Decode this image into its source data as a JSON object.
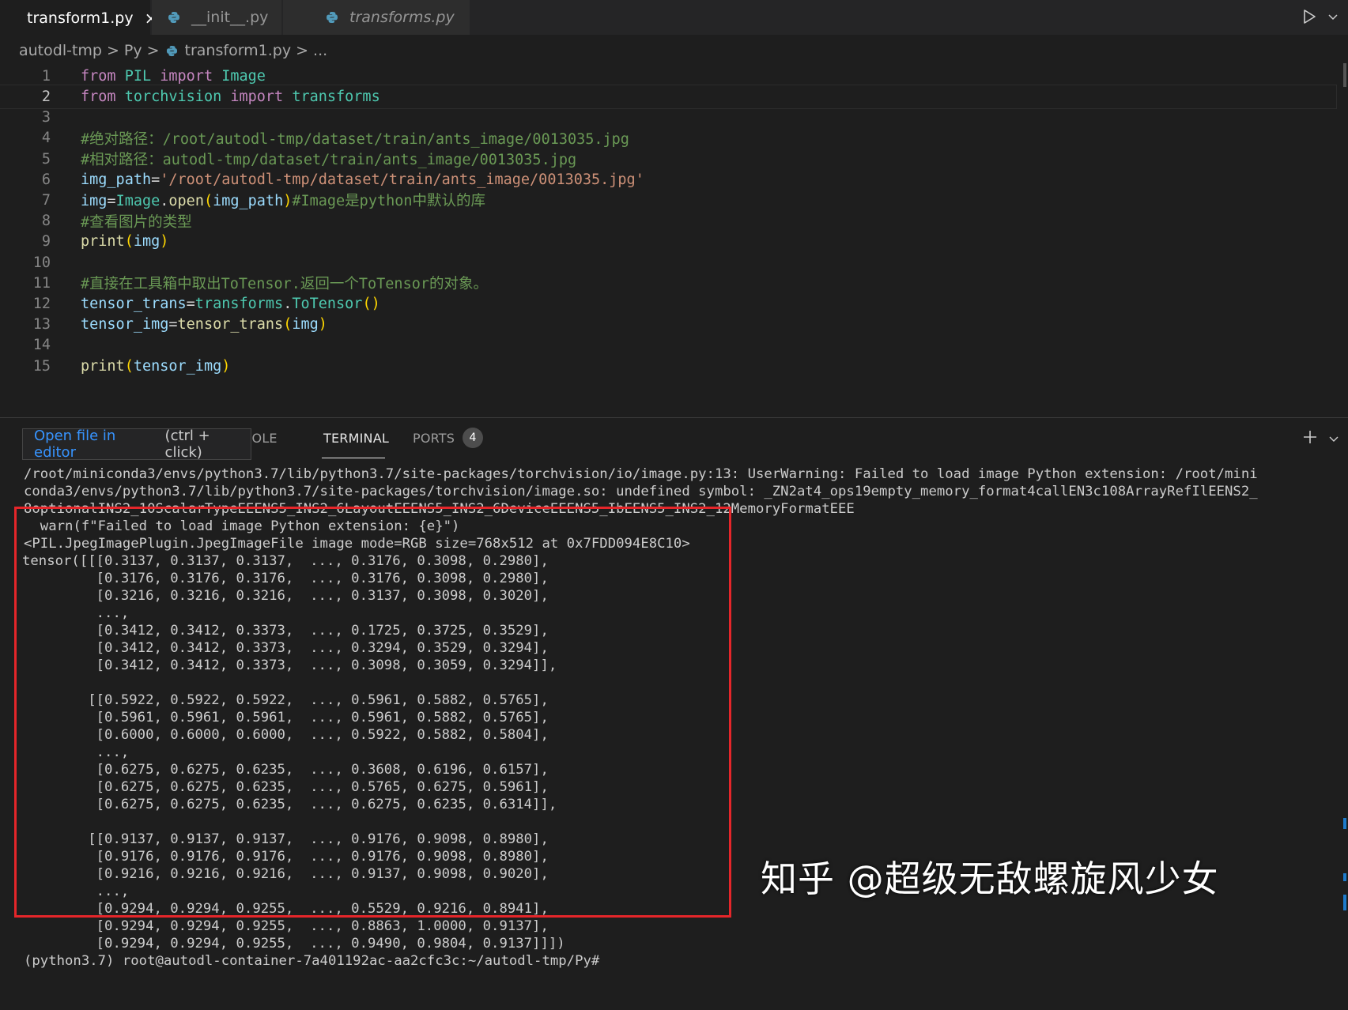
{
  "tabs": [
    {
      "label": "transform1.py",
      "close": "×"
    },
    {
      "label": "__init__.py"
    },
    {
      "label": "transforms.py"
    }
  ],
  "breadcrumb": {
    "items": [
      "autodl-tmp",
      "Py",
      "transform1.py",
      "..."
    ],
    "separator": ">"
  },
  "editor": {
    "line_numbers": [
      "1",
      "2",
      "3",
      "4",
      "5",
      "6",
      "7",
      "8",
      "9",
      "10",
      "11",
      "12",
      "13",
      "14",
      "15"
    ],
    "lines": [
      [
        {
          "t": "from",
          "c": "kw"
        },
        {
          "t": " PIL ",
          "c": "mod"
        },
        {
          "t": "import",
          "c": "kw"
        },
        {
          "t": " Image",
          "c": "mod"
        }
      ],
      [
        {
          "t": "from",
          "c": "kw"
        },
        {
          "t": " torchvision ",
          "c": "mod"
        },
        {
          "t": "import",
          "c": "kw"
        },
        {
          "t": " transforms",
          "c": "mod"
        }
      ],
      [],
      [
        {
          "t": "#绝对路径：/root/autodl-tmp/dataset/train/ants_image/0013035.jpg",
          "c": "cmt"
        }
      ],
      [
        {
          "t": "#相对路径：autodl-tmp/dataset/train/ants_image/0013035.jpg",
          "c": "cmt"
        }
      ],
      [
        {
          "t": "img_path",
          "c": "var"
        },
        {
          "t": "=",
          "c": "pun"
        },
        {
          "t": "'/root/autodl-tmp/dataset/train/ants_image/0013035.jpg'",
          "c": "str"
        }
      ],
      [
        {
          "t": "img",
          "c": "var"
        },
        {
          "t": "=",
          "c": "pun"
        },
        {
          "t": "Image",
          "c": "mod"
        },
        {
          "t": ".",
          "c": "pun"
        },
        {
          "t": "open",
          "c": "fn"
        },
        {
          "t": "(",
          "c": "par"
        },
        {
          "t": "img_path",
          "c": "var"
        },
        {
          "t": ")",
          "c": "par"
        },
        {
          "t": "#Image是python中默认的库",
          "c": "cmt"
        }
      ],
      [
        {
          "t": "#查看图片的类型",
          "c": "cmt"
        }
      ],
      [
        {
          "t": "print",
          "c": "fn"
        },
        {
          "t": "(",
          "c": "par"
        },
        {
          "t": "img",
          "c": "var"
        },
        {
          "t": ")",
          "c": "par"
        }
      ],
      [],
      [
        {
          "t": "#直接在工具箱中取出ToTensor.返回一个ToTensor的对象。",
          "c": "cmt"
        }
      ],
      [
        {
          "t": "tensor_trans",
          "c": "var"
        },
        {
          "t": "=",
          "c": "pun"
        },
        {
          "t": "transforms",
          "c": "mod"
        },
        {
          "t": ".",
          "c": "pun"
        },
        {
          "t": "ToTensor",
          "c": "mod"
        },
        {
          "t": "()",
          "c": "par"
        }
      ],
      [
        {
          "t": "tensor_img",
          "c": "var"
        },
        {
          "t": "=",
          "c": "pun"
        },
        {
          "t": "tensor_trans",
          "c": "fn"
        },
        {
          "t": "(",
          "c": "par"
        },
        {
          "t": "img",
          "c": "var"
        },
        {
          "t": ")",
          "c": "par"
        }
      ],
      [],
      [
        {
          "t": "print",
          "c": "fn"
        },
        {
          "t": "(",
          "c": "par"
        },
        {
          "t": "tensor_img",
          "c": "var"
        },
        {
          "t": ")",
          "c": "par"
        }
      ]
    ]
  },
  "panel": {
    "tooltip_link": "Open file in editor",
    "tooltip_hint": "(ctrl + click)",
    "tab_console_partial": "NSOLE",
    "tab_terminal": "TERMINAL",
    "tab_ports": "PORTS",
    "ports_count": "4"
  },
  "terminal": {
    "lines": [
      "/root/miniconda3/envs/python3.7/lib/python3.7/site-packages/torchvision/io/image.py:13: UserWarning: Failed to load image Python extension: /root/mini",
      "conda3/envs/python3.7/lib/python3.7/site-packages/torchvision/image.so: undefined symbol: _ZN2at4_ops19empty_memory_format4callEN3c108ArrayRefIlEENS2_",
      "8optionalINS2_10ScalarTypeEEENS5_INS2_6LayoutEEENS5_INS2_6DeviceEEENS5_IbEENS5_INS2_12MemoryFormatEEE",
      "  warn(f\"Failed to load image Python extension: {e}\")",
      "<PIL.JpegImagePlugin.JpegImageFile image mode=RGB size=768x512 at 0x7FDD094E8C10>",
      "tensor([[[0.3137, 0.3137, 0.3137,  ..., 0.3176, 0.3098, 0.2980],",
      "         [0.3176, 0.3176, 0.3176,  ..., 0.3176, 0.3098, 0.2980],",
      "         [0.3216, 0.3216, 0.3216,  ..., 0.3137, 0.3098, 0.3020],",
      "         ...,",
      "         [0.3412, 0.3412, 0.3373,  ..., 0.1725, 0.3725, 0.3529],",
      "         [0.3412, 0.3412, 0.3373,  ..., 0.3294, 0.3529, 0.3294],",
      "         [0.3412, 0.3412, 0.3373,  ..., 0.3098, 0.3059, 0.3294]],",
      "",
      "        [[0.5922, 0.5922, 0.5922,  ..., 0.5961, 0.5882, 0.5765],",
      "         [0.5961, 0.5961, 0.5961,  ..., 0.5961, 0.5882, 0.5765],",
      "         [0.6000, 0.6000, 0.6000,  ..., 0.5922, 0.5882, 0.5804],",
      "         ...,",
      "         [0.6275, 0.6275, 0.6235,  ..., 0.3608, 0.6196, 0.6157],",
      "         [0.6275, 0.6275, 0.6235,  ..., 0.5765, 0.6275, 0.5961],",
      "         [0.6275, 0.6275, 0.6235,  ..., 0.6275, 0.6235, 0.6314]],",
      "",
      "        [[0.9137, 0.9137, 0.9137,  ..., 0.9176, 0.9098, 0.8980],",
      "         [0.9176, 0.9176, 0.9176,  ..., 0.9176, 0.9098, 0.8980],",
      "         [0.9216, 0.9216, 0.9216,  ..., 0.9137, 0.9098, 0.9020],",
      "         ...,",
      "         [0.9294, 0.9294, 0.9255,  ..., 0.5529, 0.9216, 0.8941],",
      "         [0.9294, 0.9294, 0.9255,  ..., 0.8863, 1.0000, 0.9137],",
      "         [0.9294, 0.9294, 0.9255,  ..., 0.9490, 0.9804, 0.9137]]])",
      "(python3.7) root@autodl-container-7a401192ac-aa2cfc3c:~/autodl-tmp/Py# "
    ]
  },
  "watermark": "知乎 @超级无敌螺旋风少女",
  "colors": {
    "highlight_box": "#e5262a",
    "python_icon": "#519aba",
    "keyword": "#c586c0",
    "comment": "#6a9955",
    "string": "#ce9178"
  }
}
